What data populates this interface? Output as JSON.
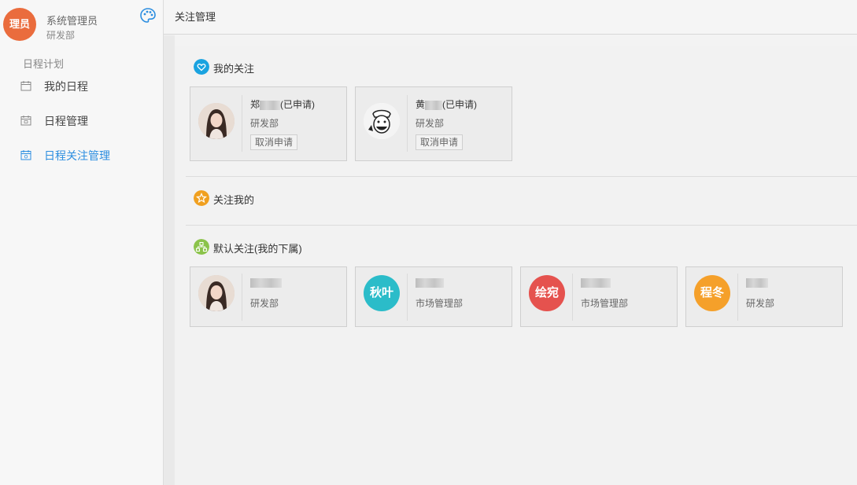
{
  "user": {
    "avatar_text": "理员",
    "name": "系统管理员",
    "dept": "研发部"
  },
  "sidebar": {
    "section_title": "日程计划",
    "items": [
      {
        "label": "我的日程",
        "icon": "calendar-icon",
        "active": false
      },
      {
        "label": "日程管理",
        "icon": "calendar-icon",
        "active": false
      },
      {
        "label": "日程关注管理",
        "icon": "calendar-icon",
        "active": true
      }
    ]
  },
  "header": {
    "title": "关注管理"
  },
  "sections": {
    "my_follow": {
      "title": "我的关注",
      "icon": "heart-icon",
      "color": "#1aa3e0"
    },
    "follow_me": {
      "title": "关注我的",
      "icon": "star-icon",
      "color": "#f0a020"
    },
    "default_follow": {
      "title": "默认关注(我的下属)",
      "icon": "org-chart-icon",
      "color": "#8bc34a"
    }
  },
  "my_follow_cards": [
    {
      "name_prefix": "郑",
      "name_suffix": "(已申请)",
      "dept": "研发部",
      "button": "取消申请",
      "avatar": "photo-woman"
    },
    {
      "name_prefix": "黄",
      "name_suffix": "(已申请)",
      "dept": "研发部",
      "button": "取消申请",
      "avatar": "photo-sketch"
    }
  ],
  "default_cards": [
    {
      "avatar_text": "",
      "dept": "研发部",
      "avatar": "photo-woman",
      "color": ""
    },
    {
      "avatar_text": "秋叶",
      "dept": "市场管理部",
      "avatar": "text",
      "color": "#2bbcc9"
    },
    {
      "avatar_text": "绘宛",
      "dept": "市场管理部",
      "avatar": "text",
      "color": "#e5524e"
    },
    {
      "avatar_text": "程冬",
      "dept": "研发部",
      "avatar": "text",
      "color": "#f5a02a"
    }
  ]
}
